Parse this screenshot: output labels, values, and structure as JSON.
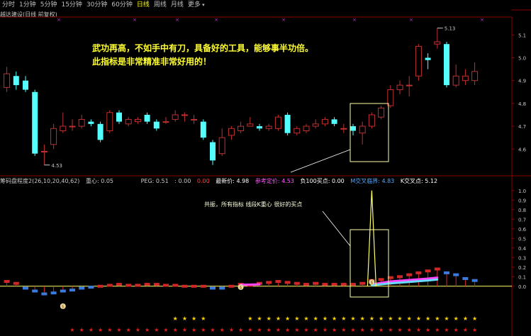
{
  "toolbar": {
    "items": [
      "分时",
      "1分钟",
      "5分钟",
      "15分钟",
      "30分钟",
      "60分钟",
      "日线",
      "周线",
      "月线",
      "更多"
    ],
    "active": "日线"
  },
  "chart_title": "越达建设(日线 前复权)",
  "annotation_main_line1": "武功再高，不如手中有刀，具备好的工具，能够事半功倍。",
  "annotation_main_line2": "此指标是非常精准非常好用的！",
  "annotation_lower": "共振，所有指标 线段K重心 很好的买点",
  "price_labels": {
    "high": "5.13",
    "low": "4.53"
  },
  "indicator_bar": {
    "name": "筹码盘程度2(26,10,20,40,62)",
    "center": "重心: 0.05",
    "peg": "PEG: 0.51",
    "colon_value": ": 0.00",
    "val_red": "0.00",
    "latest": "最新价: 4.98",
    "ref_price": "参考定价: 4.53",
    "neg_buy": "负100买点: 0.00",
    "m_cross": "M交叉临界: 4.83",
    "k_cross": "K交叉点: 5.12"
  },
  "colors": {
    "up": "#c03030",
    "down": "#54ffff",
    "active_tab": "#ffff00",
    "annotation": "#ffff33",
    "box": "#ffffaa",
    "star_yellow": "#ffd700",
    "star_red": "#e02020"
  },
  "chart_data": {
    "type": "candlestick",
    "price_axis": {
      "ticks": [
        "5.1",
        "5.0",
        "4.9",
        "4.8",
        "4.7",
        "4.6"
      ],
      "range": [
        4.52,
        5.16
      ]
    },
    "candles": [
      {
        "o": 4.87,
        "c": 4.93,
        "h": 4.96,
        "l": 4.85
      },
      {
        "o": 4.92,
        "c": 4.88,
        "h": 4.94,
        "l": 4.86
      },
      {
        "o": 4.9,
        "c": 4.86,
        "h": 4.92,
        "l": 4.85
      },
      {
        "o": 4.85,
        "c": 4.58,
        "h": 4.86,
        "l": 4.57
      },
      {
        "o": 4.59,
        "c": 4.59,
        "h": 4.62,
        "l": 4.53
      },
      {
        "o": 4.62,
        "c": 4.69,
        "h": 4.71,
        "l": 4.6
      },
      {
        "o": 4.68,
        "c": 4.7,
        "h": 4.76,
        "l": 4.67
      },
      {
        "o": 4.7,
        "c": 4.7,
        "h": 4.73,
        "l": 4.68
      },
      {
        "o": 4.7,
        "c": 4.73,
        "h": 4.75,
        "l": 4.69
      },
      {
        "o": 4.72,
        "c": 4.71,
        "h": 4.73,
        "l": 4.7
      },
      {
        "o": 4.71,
        "c": 4.64,
        "h": 4.72,
        "l": 4.63
      },
      {
        "o": 4.68,
        "c": 4.76,
        "h": 4.77,
        "l": 4.67
      },
      {
        "o": 4.76,
        "c": 4.72,
        "h": 4.77,
        "l": 4.71
      },
      {
        "o": 4.71,
        "c": 4.73,
        "h": 4.74,
        "l": 4.7
      },
      {
        "o": 4.72,
        "c": 4.73,
        "h": 4.74,
        "l": 4.71
      },
      {
        "o": 4.75,
        "c": 4.72,
        "h": 4.76,
        "l": 4.71
      },
      {
        "o": 4.72,
        "c": 4.69,
        "h": 4.73,
        "l": 4.68
      },
      {
        "o": 4.72,
        "c": 4.72,
        "h": 4.74,
        "l": 4.71
      },
      {
        "o": 4.73,
        "c": 4.75,
        "h": 4.77,
        "l": 4.72
      },
      {
        "o": 4.75,
        "c": 4.75,
        "h": 4.76,
        "l": 4.72
      },
      {
        "o": 4.73,
        "c": 4.73,
        "h": 4.75,
        "l": 4.71
      },
      {
        "o": 4.72,
        "c": 4.65,
        "h": 4.73,
        "l": 4.64
      },
      {
        "o": 4.63,
        "c": 4.55,
        "h": 4.64,
        "l": 4.53
      },
      {
        "o": 4.58,
        "c": 4.65,
        "h": 4.69,
        "l": 4.57
      },
      {
        "o": 4.66,
        "c": 4.69,
        "h": 4.7,
        "l": 4.64
      },
      {
        "o": 4.68,
        "c": 4.7,
        "h": 4.72,
        "l": 4.67
      },
      {
        "o": 4.7,
        "c": 4.71,
        "h": 4.74,
        "l": 4.7
      },
      {
        "o": 4.7,
        "c": 4.69,
        "h": 4.71,
        "l": 4.68
      },
      {
        "o": 4.69,
        "c": 4.7,
        "h": 4.71,
        "l": 4.68
      },
      {
        "o": 4.69,
        "c": 4.74,
        "h": 4.75,
        "l": 4.68
      },
      {
        "o": 4.75,
        "c": 4.67,
        "h": 4.76,
        "l": 4.66
      },
      {
        "o": 4.67,
        "c": 4.69,
        "h": 4.7,
        "l": 4.66
      },
      {
        "o": 4.68,
        "c": 4.7,
        "h": 4.71,
        "l": 4.67
      },
      {
        "o": 4.7,
        "c": 4.71,
        "h": 4.73,
        "l": 4.69
      },
      {
        "o": 4.71,
        "c": 4.73,
        "h": 4.74,
        "l": 4.7
      },
      {
        "o": 4.73,
        "c": 4.71,
        "h": 4.74,
        "l": 4.7
      },
      {
        "o": 4.69,
        "c": 4.69,
        "h": 4.71,
        "l": 4.67
      },
      {
        "o": 4.7,
        "c": 4.68,
        "h": 4.71,
        "l": 4.66
      },
      {
        "o": 4.67,
        "c": 4.7,
        "h": 4.72,
        "l": 4.62
      },
      {
        "o": 4.7,
        "c": 4.75,
        "h": 4.76,
        "l": 4.69
      },
      {
        "o": 4.74,
        "c": 4.78,
        "h": 4.79,
        "l": 4.73
      },
      {
        "o": 4.79,
        "c": 4.86,
        "h": 4.88,
        "l": 4.78
      },
      {
        "o": 4.86,
        "c": 4.88,
        "h": 4.9,
        "l": 4.84
      },
      {
        "o": 4.88,
        "c": 4.88,
        "h": 4.92,
        "l": 4.83
      },
      {
        "o": 4.92,
        "c": 5.05,
        "h": 5.06,
        "l": 4.9
      },
      {
        "o": 5.0,
        "c": 4.99,
        "h": 5.02,
        "l": 4.95
      },
      {
        "o": 5.06,
        "c": 5.07,
        "h": 5.13,
        "l": 5.04
      },
      {
        "o": 5.06,
        "c": 4.88,
        "h": 5.07,
        "l": 4.87
      },
      {
        "o": 4.88,
        "c": 4.92,
        "h": 4.97,
        "l": 4.87
      },
      {
        "o": 4.9,
        "c": 4.92,
        "h": 4.95,
        "l": 4.88
      },
      {
        "o": 4.9,
        "c": 4.94,
        "h": 4.98,
        "l": 4.88
      }
    ],
    "indicator_axis": {
      "ticks": [
        "1.0",
        "0.9",
        "0.8",
        "0.7",
        "0.6",
        "0.5",
        "0.4",
        "0.3",
        "0.2",
        "0.1",
        "0.0"
      ],
      "range": [
        -0.12,
        1.05
      ]
    },
    "indicator_bars": [
      0.05,
      0.03,
      -0.02,
      -0.05,
      -0.08,
      -0.07,
      -0.05,
      -0.04,
      -0.02,
      -0.01,
      0.0,
      0.01,
      0.02,
      0.01,
      0.01,
      0.02,
      0.02,
      0.01,
      0.01,
      0.0,
      0.0,
      0.0,
      -0.02,
      -0.02,
      0.0,
      0.02,
      0.01,
      0.03,
      0.04,
      0.05,
      0.04,
      0.03,
      0.02,
      0.03,
      0.02,
      0.02,
      0.02,
      0.02,
      0.03,
      0.06,
      0.07,
      0.09,
      0.1,
      0.12,
      0.14,
      0.16,
      0.18,
      0.14,
      0.12,
      0.08,
      0.06
    ],
    "spike_value": 1.0
  }
}
